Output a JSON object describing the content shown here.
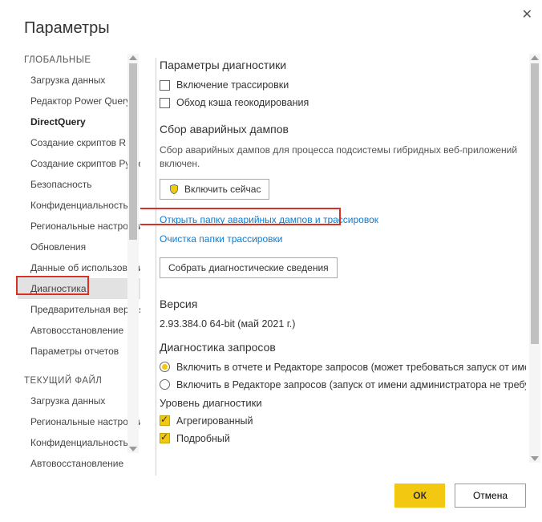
{
  "title": "Параметры",
  "sidebar": {
    "sections": [
      {
        "head": "ГЛОБАЛЬНЫЕ",
        "items": [
          "Загрузка данных",
          "Редактор Power Query",
          "DirectQuery",
          "Создание скриптов R",
          "Создание скриптов Python",
          "Безопасность",
          "Конфиденциальность",
          "Региональные настройки",
          "Обновления",
          "Данные об использовании",
          "Диагностика",
          "Предварительная версия функций",
          "Автовосстановление",
          "Параметры отчетов"
        ]
      },
      {
        "head": "ТЕКУЩИЙ ФАЙЛ",
        "items": [
          "Загрузка данных",
          "Региональные настройки",
          "Конфиденциальность",
          "Автовосстановление"
        ]
      }
    ]
  },
  "content": {
    "diag_settings_head": "Параметры диагностики",
    "enable_tracing": "Включение трассировки",
    "bypass_geocache": "Обход кэша геокодирования",
    "crash_head": "Сбор аварийных дампов",
    "crash_note": "Сбор аварийных дампов для процесса подсистемы гибридных веб-приложений включен.",
    "enable_now_btn": "Включить сейчас",
    "open_folder_link": "Открыть папку аварийных дампов и трассировок",
    "clear_folder_link": "Очистка папки трассировки",
    "collect_diag_btn": "Собрать диагностические сведения",
    "version_head": "Версия",
    "version_value": "2.93.384.0 64-bit (май 2021 г.)",
    "query_diag_head": "Диагностика запросов",
    "radio1": "Включить в отчете и Редакторе запросов (может требоваться запуск от имени администратора)",
    "radio2": "Включить в Редакторе запросов (запуск от имени администратора не требуется)",
    "diag_level": "Уровень диагностики",
    "aggregated": "Агрегированный",
    "detailed": "Подробный"
  },
  "footer": {
    "ok": "ОК",
    "cancel": "Отмена"
  }
}
